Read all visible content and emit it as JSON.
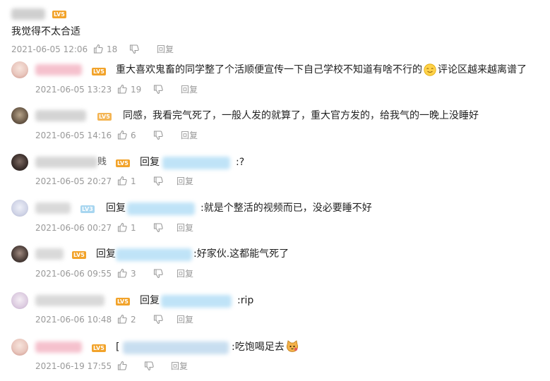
{
  "comments": [
    {
      "text": "我觉得不太合适",
      "time": "2021-06-05 12:06",
      "likes": "18",
      "reply_label": "回复",
      "level": "LV5"
    },
    {
      "text": "重大喜欢鬼畜的同学整了个活顺便宣传一下自己学校不知道有啥不行的",
      "text_after_emoji": "评论区越来越离谱了",
      "time": "2021-06-05 13:23",
      "likes": "19",
      "reply_label": "回复",
      "level": "LV5"
    },
    {
      "text": "同感，我看完气死了，一般人发的就算了，重大官方发的，给我气的一晚上没睡好",
      "time": "2021-06-05 14:16",
      "likes": "6",
      "reply_label": "回复",
      "level": "LV5"
    },
    {
      "name_suffix": "贱",
      "reply_prefix": "回复",
      "text": ":?",
      "time": "2021-06-05 20:27",
      "likes": "1",
      "reply_label": "回复",
      "level": "LV5"
    },
    {
      "reply_prefix": "回复",
      "text": ":就是个整活的视频而已，没必要睡不好",
      "time": "2021-06-06 00:27",
      "likes": "1",
      "reply_label": "回复",
      "level": "LV3"
    },
    {
      "reply_prefix": "回复",
      "text": ":好家伙.这都能气死了",
      "time": "2021-06-06 09:55",
      "likes": "3",
      "reply_label": "回复",
      "level": "LV5"
    },
    {
      "reply_prefix": "回复",
      "text": ":rip",
      "time": "2021-06-06 10:48",
      "likes": "2",
      "reply_label": "回复",
      "level": "LV5"
    },
    {
      "reply_prefix": "[",
      "text": ":吃饱喝足去",
      "time": "2021-06-19 17:55",
      "likes": "",
      "reply_label": "回复",
      "level": "LV5"
    }
  ],
  "colors": {
    "level_orange": "#f2a32a",
    "level_blue": "#a8d6f0",
    "meta_gray": "#999999",
    "mention_blue": "#bfe3f7"
  }
}
